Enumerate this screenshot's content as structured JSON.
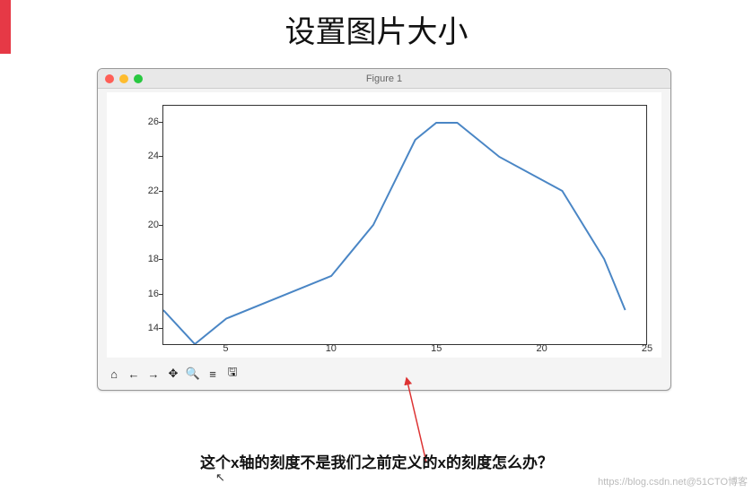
{
  "page": {
    "title": "设置图片大小",
    "caption": "这个x轴的刻度不是我们之前定义的x的刻度怎么办？",
    "watermark": "https://blog.csdn.net@51CTO博客"
  },
  "window": {
    "title": "Figure 1"
  },
  "toolbar": {
    "home": "⌂",
    "back": "←",
    "forward": "→",
    "pan": "✥",
    "zoom": "🔍",
    "config": "≡",
    "save": "🖫"
  },
  "chart_data": {
    "type": "line",
    "x": [
      2,
      3,
      4,
      5,
      6,
      7,
      8,
      9,
      10,
      11,
      12,
      13,
      14,
      15,
      16,
      17,
      18,
      19,
      20,
      21,
      22,
      23,
      24
    ],
    "y": [
      15,
      13,
      14.5,
      17,
      20,
      25,
      26,
      26,
      24,
      22,
      18,
      15
    ],
    "x_for_y": [
      2,
      3.5,
      5,
      10,
      12,
      14,
      15,
      16,
      18,
      21,
      23,
      24
    ],
    "xticks": [
      5,
      10,
      15,
      20,
      25
    ],
    "yticks": [
      14,
      16,
      18,
      20,
      22,
      24,
      26
    ],
    "xlim": [
      2,
      25
    ],
    "ylim": [
      13,
      27
    ],
    "title": "",
    "xlabel": "",
    "ylabel": ""
  }
}
